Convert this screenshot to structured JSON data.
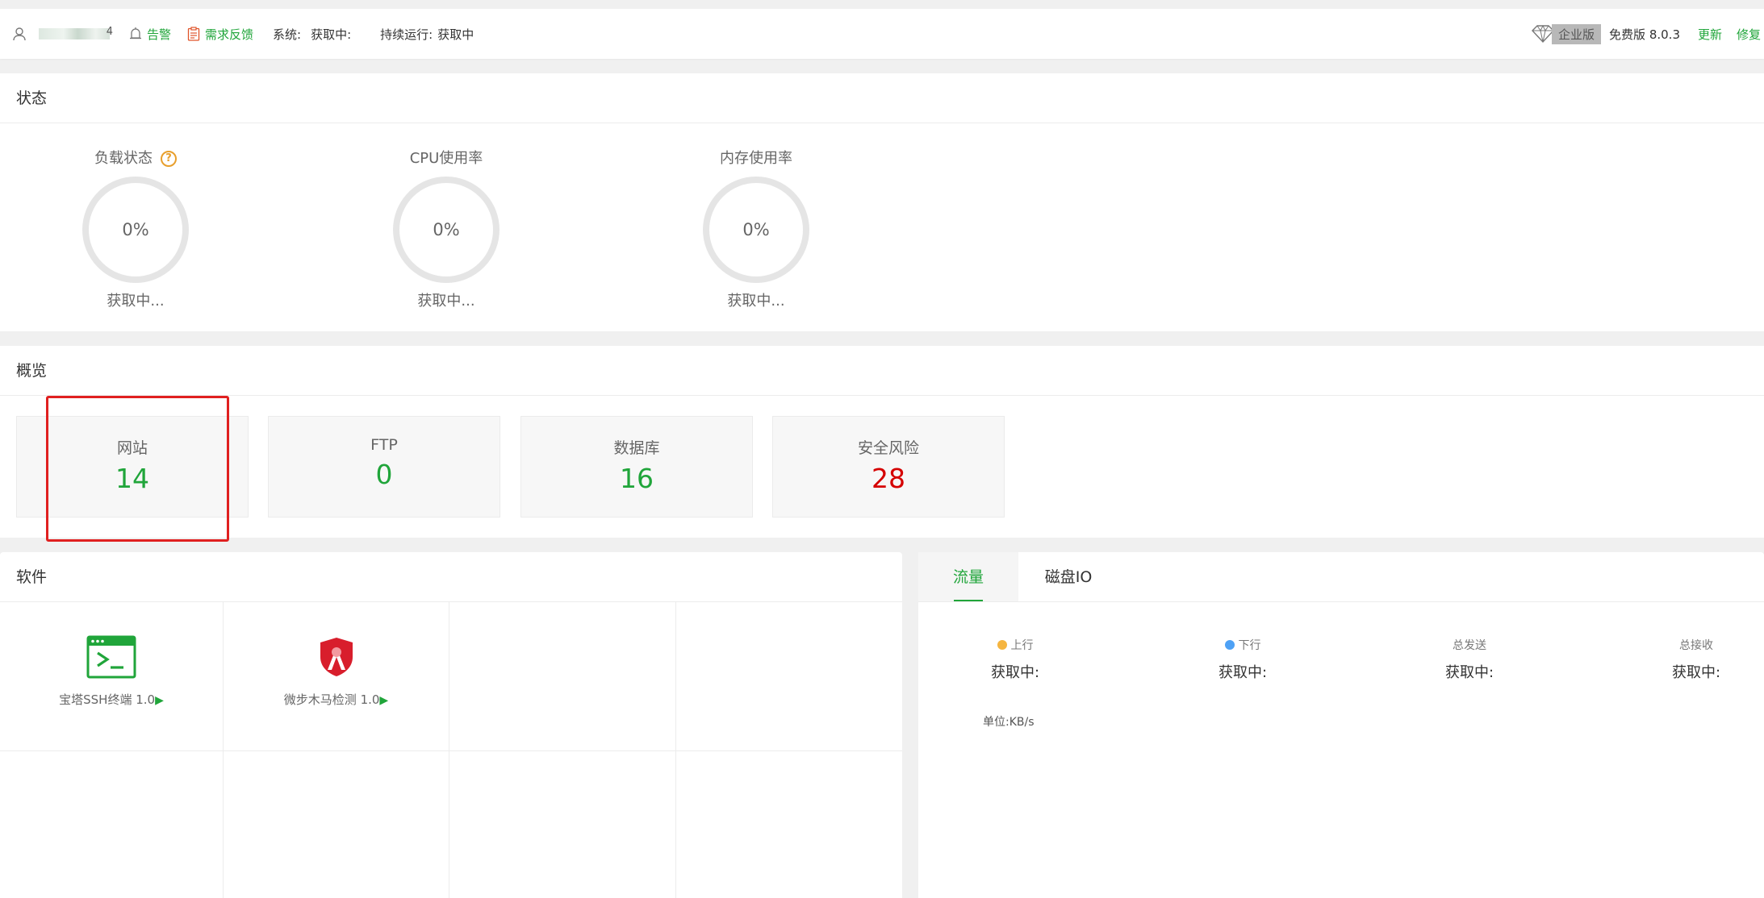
{
  "topbar": {
    "alert_label": "告警",
    "feedback_label": "需求反馈",
    "system_label": "系统:",
    "system_value": "获取中:",
    "uptime_label": "持续运行:",
    "uptime_value": "获取中",
    "enterprise_label": "企业版",
    "free_label": "免费版 8.0.3",
    "update_label": "更新",
    "repair_label": "修复"
  },
  "status": {
    "title": "状态",
    "gauges": [
      {
        "label": "负载状态",
        "value": "0%",
        "sub": "获取中..."
      },
      {
        "label": "CPU使用率",
        "value": "0%",
        "sub": "获取中..."
      },
      {
        "label": "内存使用率",
        "value": "0%",
        "sub": "获取中..."
      }
    ]
  },
  "overview": {
    "title": "概览",
    "cards": [
      {
        "label": "网站",
        "value": "14"
      },
      {
        "label": "FTP",
        "value": "0"
      },
      {
        "label": "数据库",
        "value": "16"
      },
      {
        "label": "安全风险",
        "value": "28"
      }
    ]
  },
  "software": {
    "title": "软件",
    "items": [
      {
        "name": "宝塔SSH终端 1.0",
        "icon": "terminal-icon"
      },
      {
        "name": "微步木马检测 1.0",
        "icon": "shield-icon"
      }
    ]
  },
  "traffic": {
    "tabs": [
      "流量",
      "磁盘IO"
    ],
    "stats": [
      {
        "label": "上行",
        "value": "获取中:",
        "color": "#f5b540"
      },
      {
        "label": "下行",
        "value": "获取中:",
        "color": "#4ea1f5"
      },
      {
        "label": "总发送",
        "value": "获取中:"
      },
      {
        "label": "总接收",
        "value": "获取中:"
      }
    ],
    "unit": "单位:KB/s"
  },
  "colors": {
    "accent": "#20a53a",
    "danger": "#d50000",
    "highlight": "#e02020"
  }
}
